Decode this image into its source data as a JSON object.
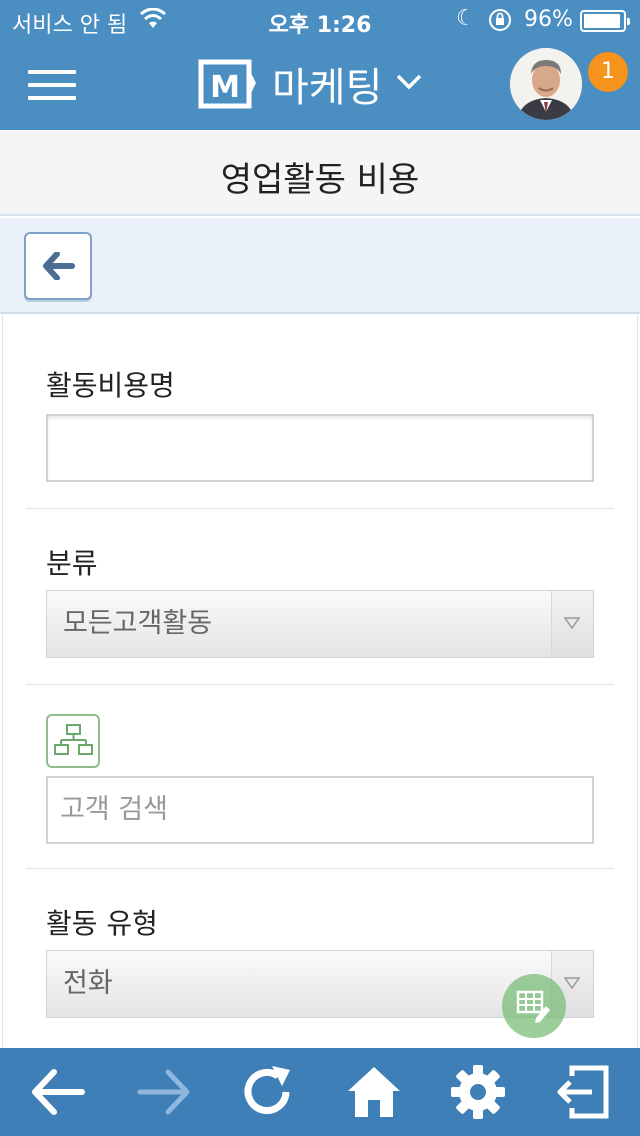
{
  "status_bar": {
    "carrier": "서비스 안 됨",
    "time": "오후 1:26",
    "battery": "96%",
    "icons": [
      "wifi-icon",
      "moon-icon",
      "rotation-lock-icon",
      "battery-icon"
    ]
  },
  "header": {
    "app_name": "마케팅",
    "logo_letter": "M",
    "notification_count": "1",
    "icons": [
      "hamburger-menu-icon",
      "chevron-down-icon",
      "avatar"
    ]
  },
  "page": {
    "title": "영업활동 비용"
  },
  "form": {
    "activity_cost_name": {
      "label": "활동비용명",
      "value": ""
    },
    "category": {
      "label": "분류",
      "selected": "모든고객활동"
    },
    "customer_search": {
      "placeholder": "고객 검색"
    },
    "activity_type": {
      "label": "활동 유형",
      "selected": "전화"
    }
  },
  "colors": {
    "header_blue": "#4a8ec2",
    "bottom_nav_blue": "#3f7fb8",
    "badge_orange": "#f7941d",
    "green_accent": "#8fbc8f"
  },
  "bottom_nav": {
    "items": [
      "back-arrow-icon",
      "forward-arrow-icon",
      "refresh-icon",
      "home-icon",
      "gear-icon",
      "logout-icon"
    ]
  }
}
